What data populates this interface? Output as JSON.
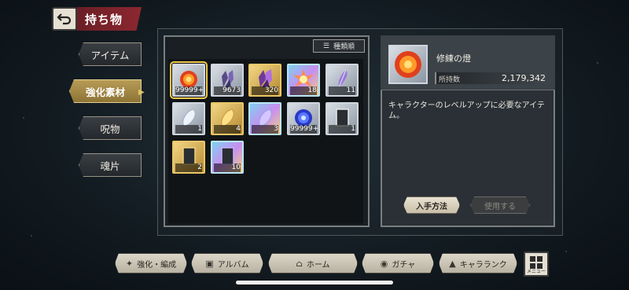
{
  "header": {
    "title": "持ち物",
    "back_icon": "back-arrow-icon"
  },
  "side_tabs": [
    {
      "label": "アイテム",
      "active": false
    },
    {
      "label": "強化素材",
      "active": true
    },
    {
      "label": "呪物",
      "active": false
    },
    {
      "label": "魂片",
      "active": false
    }
  ],
  "sort_button": {
    "label": "種類順",
    "icon": "sort-icon"
  },
  "items": [
    {
      "count": "99999+",
      "icon": "flame-orb-icon",
      "rarity": "silver",
      "selected": true
    },
    {
      "count": "9673",
      "icon": "dark-crystal-icon",
      "rarity": "silver"
    },
    {
      "count": "320",
      "icon": "purple-crystal-icon",
      "rarity": "gold"
    },
    {
      "count": "18",
      "icon": "burst-crystal-icon",
      "rarity": "rainbow"
    },
    {
      "count": "11",
      "icon": "feather-icon",
      "rarity": "silver"
    },
    {
      "count": "1",
      "icon": "white-stone-icon",
      "rarity": "silver"
    },
    {
      "count": "4",
      "icon": "gold-stone-icon",
      "rarity": "gold"
    },
    {
      "count": "3",
      "icon": "rainbow-stone-icon",
      "rarity": "rainbow"
    },
    {
      "count": "99999+",
      "icon": "blue-orb-icon",
      "rarity": "silver"
    },
    {
      "count": "1",
      "icon": "card-icon",
      "rarity": "silver"
    },
    {
      "count": "2",
      "icon": "card-icon",
      "rarity": "gold"
    },
    {
      "count": "10",
      "icon": "card-icon",
      "rarity": "rainbow"
    }
  ],
  "detail": {
    "name": "修練の燈",
    "owned_label": "所持数",
    "owned_value": "2,179,342",
    "description": "キャラクターのレベルアップに必要なアイテム。",
    "acquire_label": "入手方法",
    "use_label": "使用する"
  },
  "bottom_nav": [
    {
      "label": "強化・編成",
      "icon": "enhance-icon"
    },
    {
      "label": "アルバム",
      "icon": "album-icon"
    },
    {
      "label": "ホーム",
      "icon": "home-icon"
    },
    {
      "label": "ガチャ",
      "icon": "gacha-icon"
    },
    {
      "label": "キャラランク",
      "icon": "rank-icon"
    }
  ],
  "menu": {
    "label": "メニュー",
    "icon": "menu-grid-icon"
  }
}
